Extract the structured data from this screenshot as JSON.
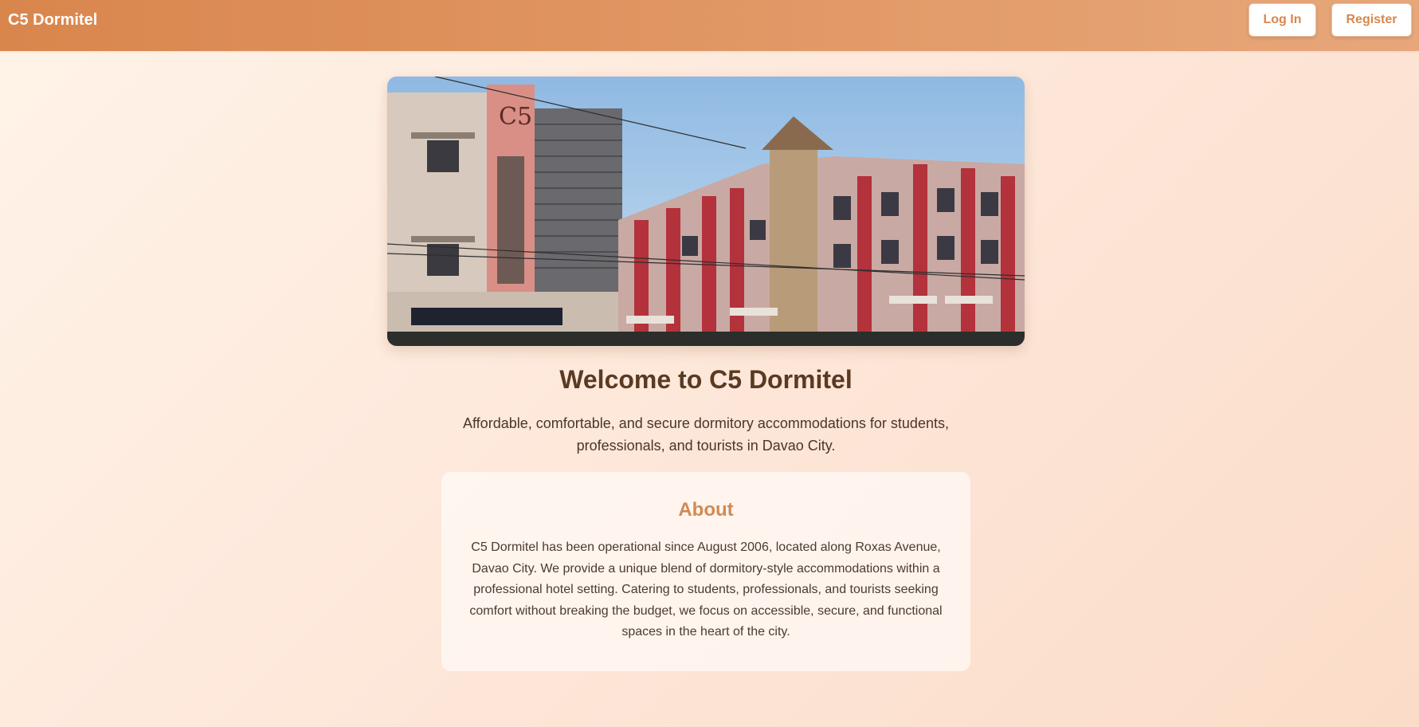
{
  "navbar": {
    "brand": "C5 Dormitel",
    "login_label": "Log In",
    "register_label": "Register"
  },
  "hero": {
    "building_logo_text": "C5"
  },
  "main": {
    "welcome_title": "Welcome to C5 Dormitel",
    "tagline": "Affordable, comfortable, and secure dormitory accommodations for students, professionals, and tourists in Davao City."
  },
  "about": {
    "title": "About",
    "body": "C5 Dormitel has been operational since August 2006, located along Roxas Avenue, Davao City. We provide a unique blend of dormitory-style accommodations within a professional hotel setting. Catering to students, professionals, and tourists seeking comfort without breaking the budget, we focus on accessible, secure, and functional spaces in the heart of the city."
  },
  "colors": {
    "navbar_start": "#d9864d",
    "navbar_end": "#e7a77a",
    "accent": "#d08a55",
    "page_background": "#fde6d8",
    "heading_text": "#5a3a22"
  }
}
